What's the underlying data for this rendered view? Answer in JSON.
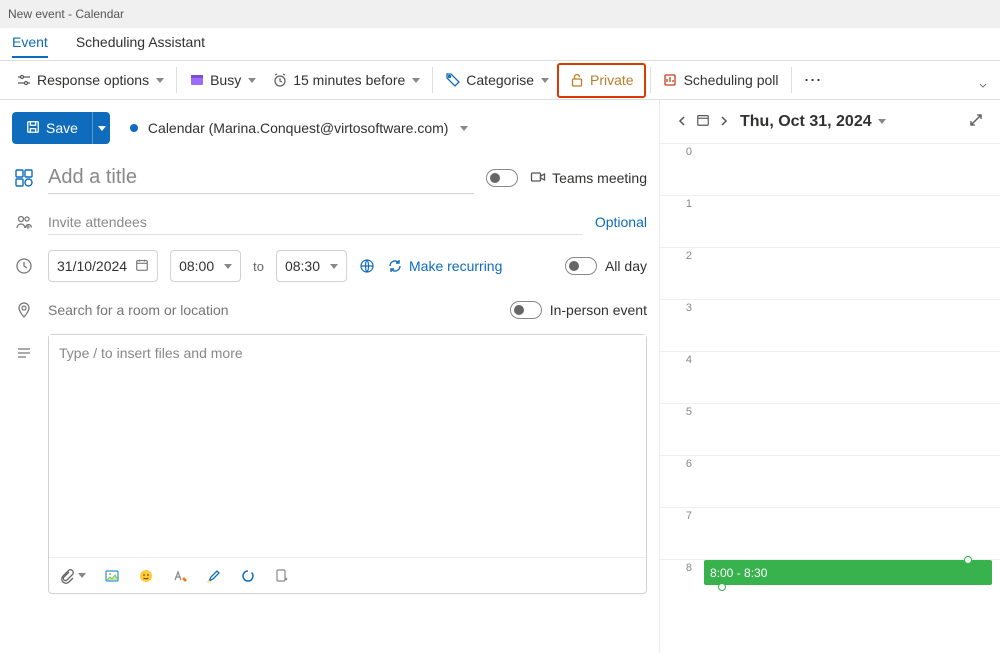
{
  "window": {
    "title": "New event - Calendar"
  },
  "tabs": {
    "event": "Event",
    "scheduling_assistant": "Scheduling Assistant"
  },
  "ribbon": {
    "response_options": "Response options",
    "busy": "Busy",
    "reminder": "15 minutes before",
    "categorise": "Categorise",
    "private": "Private",
    "scheduling_poll": "Scheduling poll"
  },
  "form": {
    "save": "Save",
    "calendar_name": "Calendar (Marina.Conquest@virtosoftware.com)",
    "title_placeholder": "Add a title",
    "teams_meeting": "Teams meeting",
    "attendees_placeholder": "Invite attendees",
    "optional": "Optional",
    "date": "31/10/2024",
    "start_time": "08:00",
    "end_time": "08:30",
    "to": "to",
    "make_recurring": "Make recurring",
    "all_day": "All day",
    "location_placeholder": "Search for a room or location",
    "in_person": "In-person event",
    "description_placeholder": "Type / to insert files and more"
  },
  "day_panel": {
    "date": "Thu, Oct 31, 2024",
    "hours": [
      "0",
      "1",
      "2",
      "3",
      "4",
      "5",
      "6",
      "7",
      "8"
    ],
    "event_label": "8:00 - 8:30",
    "event_color": "#37b24d"
  }
}
